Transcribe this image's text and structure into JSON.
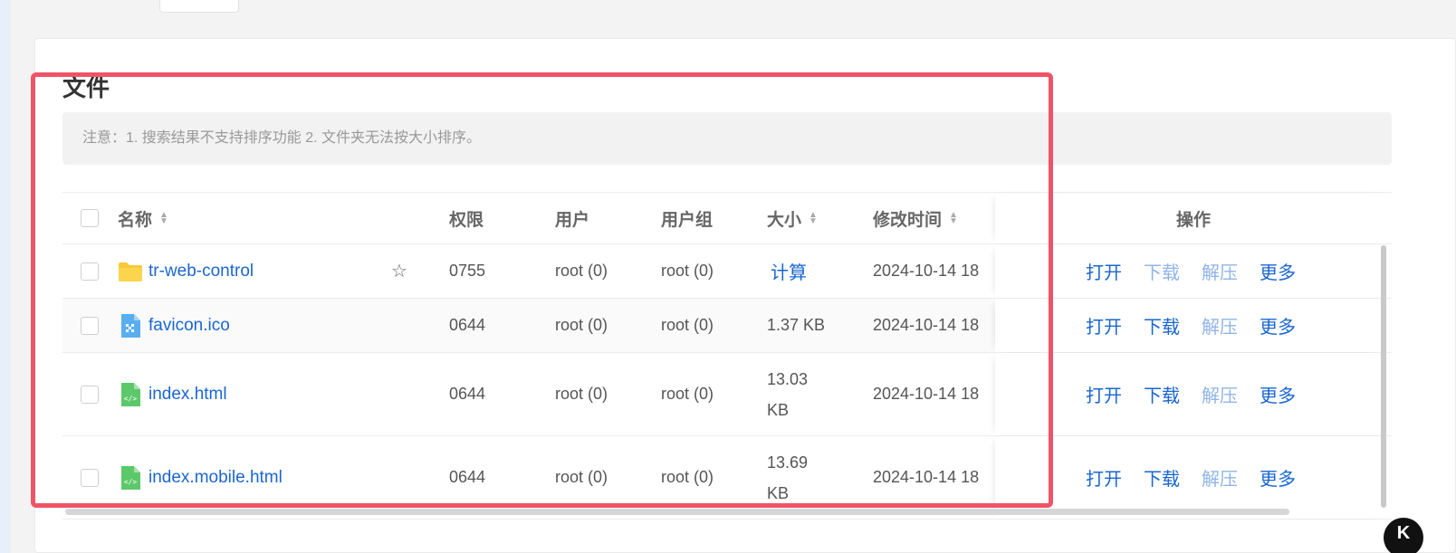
{
  "page": {
    "title": "文件",
    "notice": "注意：1. 搜索结果不支持排序功能 2. 文件夹无法按大小排序。"
  },
  "columns": {
    "name": "名称",
    "perm": "权限",
    "user": "用户",
    "group": "用户组",
    "size": "大小",
    "time": "修改时间",
    "ops": "操作"
  },
  "rows": [
    {
      "name": "tr-web-control",
      "icon": "folder-icon",
      "perm": "0755",
      "user": "root (0)",
      "group": "root (0)",
      "size": "计算",
      "time": "2024-10-14 18",
      "starred": false
    },
    {
      "name": "favicon.ico",
      "icon": "image-file-icon",
      "perm": "0644",
      "user": "root (0)",
      "group": "root (0)",
      "size": "1.37 KB",
      "time": "2024-10-14 18"
    },
    {
      "name": "index.html",
      "icon": "html-file-icon",
      "perm": "0644",
      "user": "root (0)",
      "group": "root (0)",
      "size_line1": "13.03",
      "size_line2": "KB",
      "time": "2024-10-14 18"
    },
    {
      "name": "index.mobile.html",
      "icon": "html-file-icon",
      "perm": "0644",
      "user": "root (0)",
      "group": "root (0)",
      "size_line1": "13.69",
      "size_line2": "KB",
      "time": "2024-10-14 18"
    }
  ],
  "ops": {
    "open": "打开",
    "download": "下载",
    "extract": "解压",
    "more": "更多"
  },
  "badge": {
    "text": "K"
  },
  "colors": {
    "link": "#1a66d0",
    "link_disabled": "#8fb4e6",
    "highlight": "#ef5466"
  }
}
